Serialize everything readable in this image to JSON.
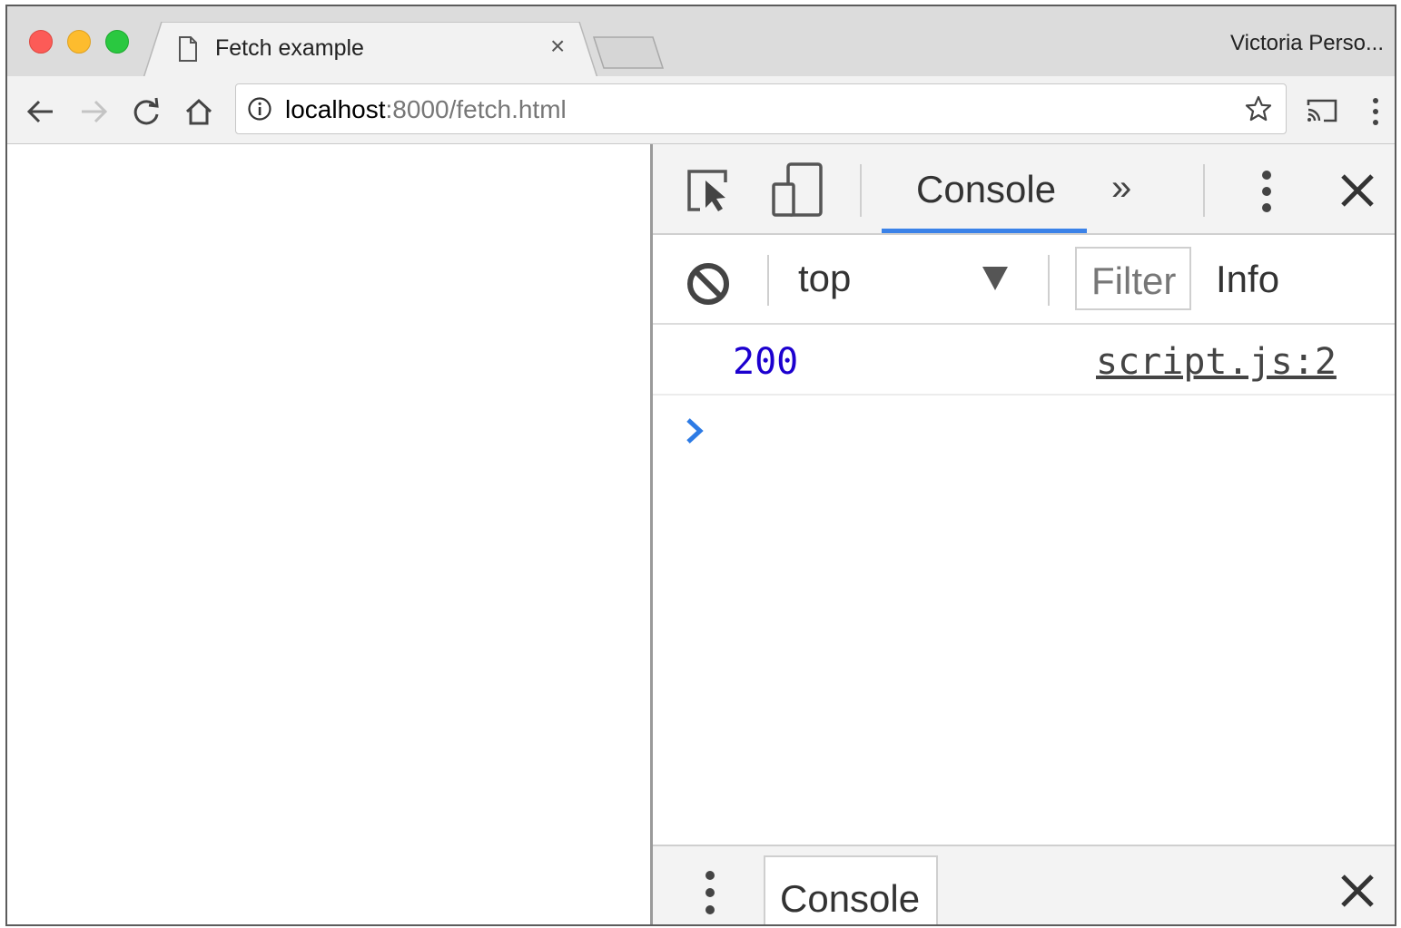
{
  "browser": {
    "tab_title": "Fetch example",
    "tab_close": "×",
    "profile_name": "Victoria Perso...",
    "url_host": "localhost",
    "url_rest": ":8000/fetch.html"
  },
  "devtools": {
    "active_tab": "Console",
    "more_tabs": "»",
    "context": "top",
    "filter_placeholder": "Filter",
    "levels": "Info",
    "log_entries": [
      {
        "value": "200",
        "source": "script.js:2"
      }
    ],
    "drawer_tab": "Console"
  },
  "colors": {
    "accent": "#3b82e8",
    "log_value": "#1c00cf"
  },
  "icons": [
    "document-icon",
    "back-arrow-icon",
    "forward-arrow-icon",
    "reload-icon",
    "home-icon",
    "info-icon",
    "star-icon",
    "cast-icon",
    "menu-icon",
    "inspect-element-icon",
    "device-toggle-icon",
    "kebab-menu-icon",
    "close-icon",
    "clear-console-icon",
    "dropdown-arrow-icon",
    "prompt-chevron-icon"
  ]
}
